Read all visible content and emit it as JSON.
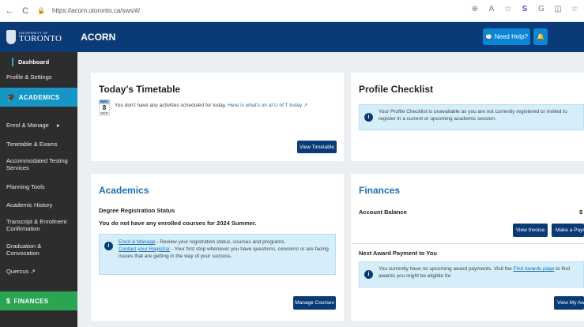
{
  "browser": {
    "url": "https://acorn.utoronto.ca/sws/#/",
    "nav_back": "←",
    "nav_reload": "C",
    "lock": "🔒",
    "right_icons": [
      "⊕",
      "A",
      "☆",
      "S",
      "G",
      "◫",
      "☆"
    ]
  },
  "header": {
    "logo_small": "UNIVERSITY OF",
    "logo_big": "TORONTO",
    "app_title": "ACORN",
    "help_label": "Need Help?",
    "help_icon": "💬",
    "bell_icon": "🔔"
  },
  "sidebar": {
    "active": "Dashboard",
    "items": {
      "profile": "Profile & Settings",
      "academics_section": "ACADEMICS",
      "enrol": "Enrol & Manage",
      "enrol_chevron": "▸",
      "timetable": "Timetable & Exams",
      "accommodated": "Accommodated Testing Services",
      "planning": "Planning Tools",
      "history": "Academic History",
      "transcript": "Transcript & Enrolment Confirmation",
      "graduation": "Graduation & Convocation",
      "quercus": "Quercus",
      "finances_section": "FINANCES"
    },
    "academics_icon": "🎓",
    "finances_icon": "$",
    "quercus_icon": "↗"
  },
  "timetable": {
    "title": "Today's Timetable",
    "date_month": "MAY",
    "date_day": "8",
    "date_dow": "WED",
    "message": "You don't have any activities scheduled for today.",
    "link": "Here is what's on at U of T today",
    "link_icon": "↗",
    "button": "View Timetable"
  },
  "profile_checklist": {
    "title": "Profile Checklist",
    "info": "Your Profile Checklist is unavailable as you are not currently registered or invited to register in a current or upcoming academic session."
  },
  "academics": {
    "title": "Academics",
    "status_label": "Degree Registration Status",
    "status_text": "You do not have any enrolled courses for 2024 Summer.",
    "info_link1": "Enrol & Manage",
    "info_text1": " - Review your registration status, courses and programs.",
    "info_link2": "Contact your Registrar",
    "info_text2": " - Your first stop whenever you have questions, concerns or are facing issues that are getting in the way of your success.",
    "button": "Manage Courses"
  },
  "finances": {
    "title": "Finances",
    "balance_label": "Account Balance",
    "balance_value": "$",
    "btn_invoice": "View Invoice",
    "btn_pay": "Make a Payment",
    "award_label": "Next Award Payment to You",
    "award_info": "You currently have no upcoming award payments. Visit the",
    "award_link": "Find Awards page",
    "award_info2": "to find awards you might be eligible for.",
    "btn_awards": "View My Awards"
  }
}
